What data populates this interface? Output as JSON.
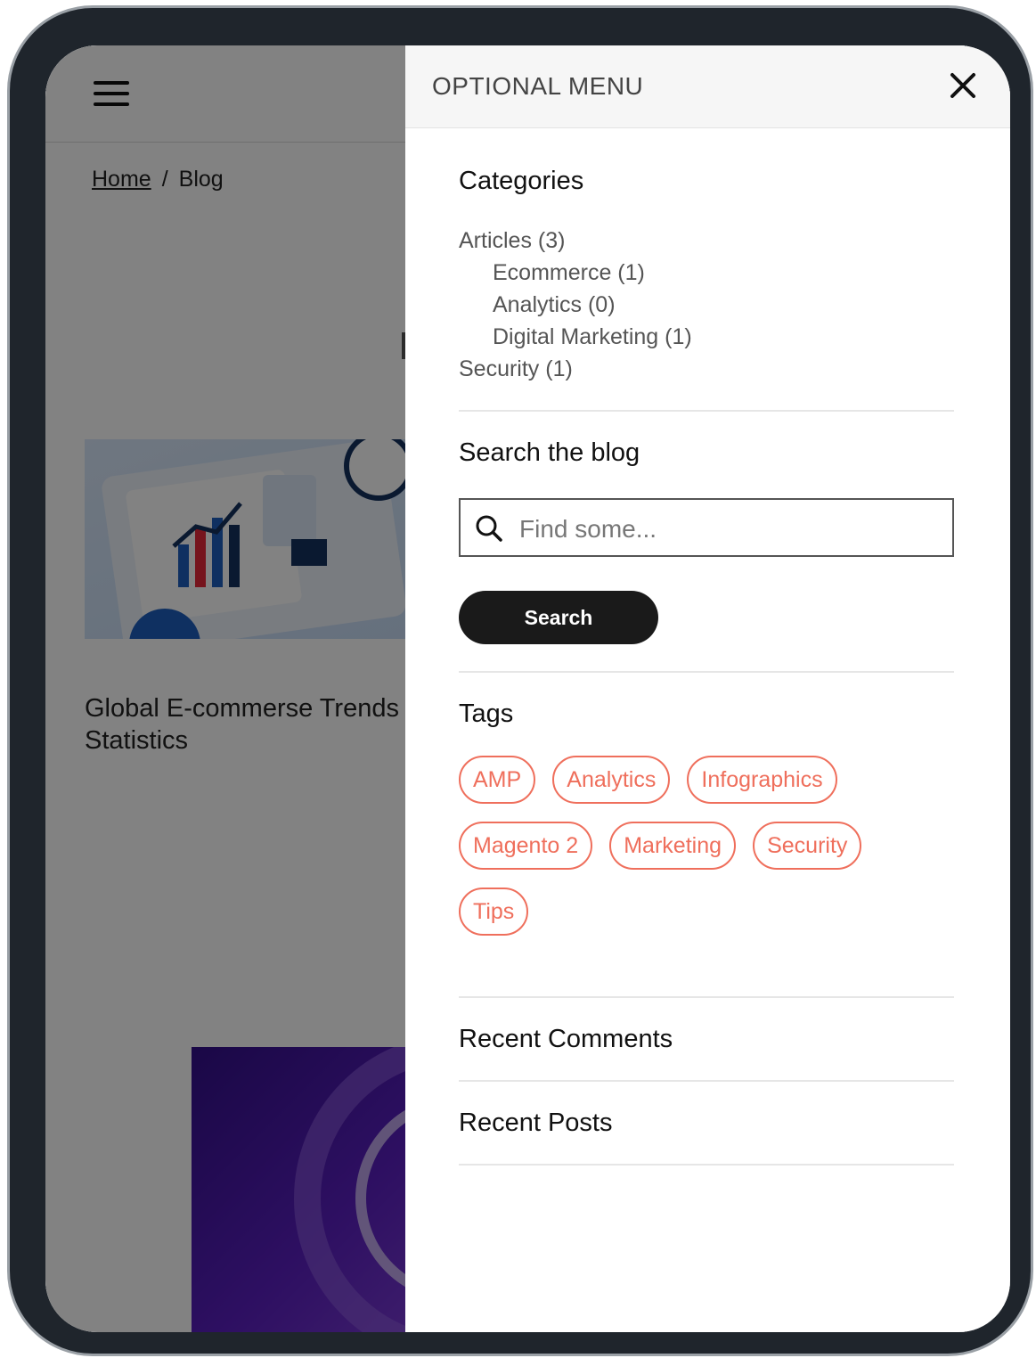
{
  "page": {
    "breadcrumb": {
      "home": "Home",
      "separator": "/",
      "current": "Blog"
    },
    "post_titles": [
      "Global E-commerse Trends Statistics"
    ]
  },
  "panel": {
    "title": "OPTIONAL MENU",
    "categories": {
      "title": "Categories",
      "items": [
        {
          "label": "Articles (3)",
          "level": 0
        },
        {
          "label": "Ecommerce (1)",
          "level": 1
        },
        {
          "label": "Analytics (0)",
          "level": 1
        },
        {
          "label": "Digital Marketing (1)",
          "level": 1
        },
        {
          "label": "Security (1)",
          "level": 0
        }
      ]
    },
    "search": {
      "title": "Search the blog",
      "placeholder": "Find some...",
      "value": "",
      "button_label": "Search"
    },
    "tags": {
      "title": "Tags",
      "items": [
        "AMP",
        "Analytics",
        "Infographics",
        "Magento 2",
        "Marketing",
        "Security",
        "Tips"
      ]
    },
    "recent_comments": {
      "title": "Recent Comments"
    },
    "recent_posts": {
      "title": "Recent Posts"
    }
  },
  "colors": {
    "tag_accent": "#ef6f5c",
    "button_bg": "#1a1a1a",
    "device_frame": "#1f252c"
  },
  "icons": [
    "hamburger-icon",
    "close-icon",
    "search-icon"
  ]
}
